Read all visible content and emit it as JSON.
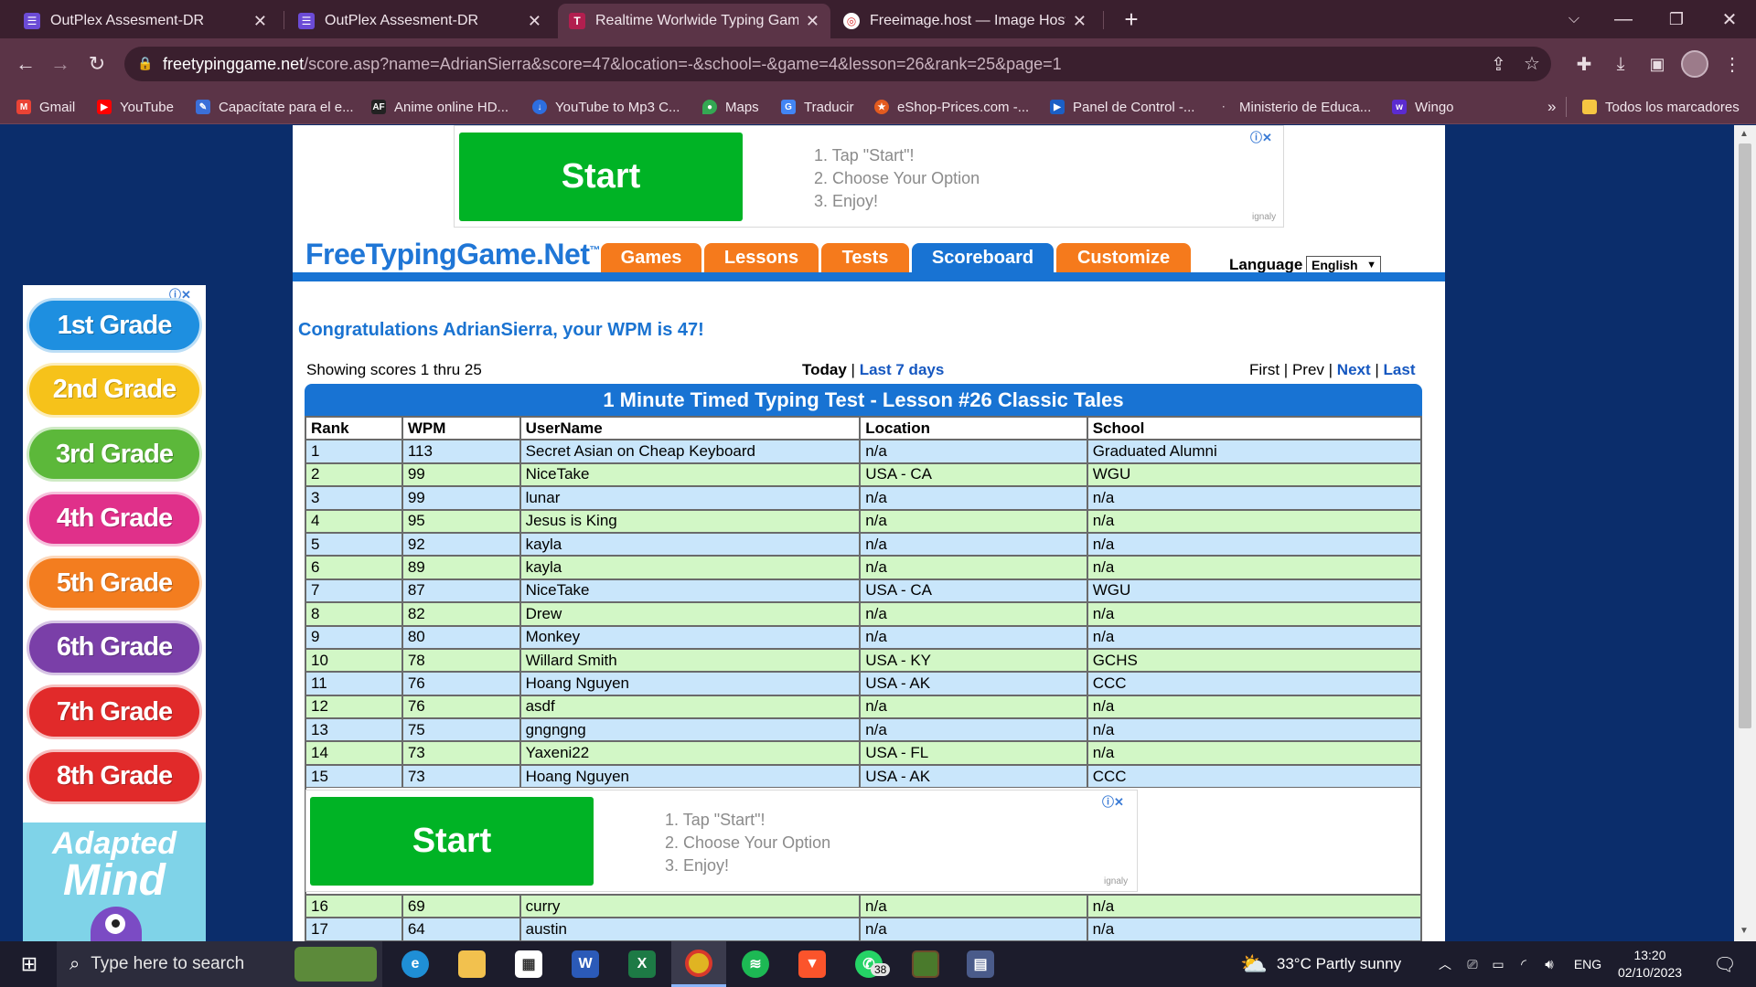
{
  "tabs": [
    {
      "label": "OutPlex Assesment-DR",
      "icon": "form-icon"
    },
    {
      "label": "OutPlex Assesment-DR",
      "icon": "form-icon"
    },
    {
      "label": "Realtime Worlwide Typing Game",
      "icon": "t-logo-icon"
    },
    {
      "label": "Freeimage.host — Image Hosting",
      "icon": "freeimage-icon"
    }
  ],
  "url": {
    "domain": "freetypinggame.net",
    "path": "/score.asp?name=AdrianSierra&score=47&location=-&school=-&game=4&lesson=26&rank=25&page=1"
  },
  "bookmarks": [
    "Gmail",
    "YouTube",
    "Capacítate para el e...",
    "Anime online HD...",
    "YouTube to Mp3 C...",
    "Maps",
    "Traducir",
    "eShop-Prices.com -...",
    "Panel de Control -...",
    "Ministerio de Educa...",
    "Wingo"
  ],
  "bookmarks_more": "»",
  "all_bookmarks": "Todos los marcadores",
  "ad": {
    "start": "Start",
    "steps": [
      "1. Tap \"Start\"!",
      "2. Choose Your Option",
      "3. Enjoy!"
    ],
    "brand": "ignaly"
  },
  "site": {
    "logo": "FreeTypingGame.Net",
    "logo_tm": "™",
    "nav": [
      "Games",
      "Lessons",
      "Tests",
      "Scoreboard",
      "Customize"
    ],
    "language_label": "Language",
    "language_value": "English"
  },
  "congrats": "Congratulations AdrianSierra, your WPM is 47!",
  "showing": "Showing scores 1 thru 25",
  "period": {
    "today": "Today",
    "sep": "|",
    "last7": "Last 7 days"
  },
  "paging": {
    "first": "First",
    "prev": "Prev",
    "next": "Next",
    "last": "Last",
    "sep": "|"
  },
  "table_title": "1 Minute Timed Typing Test - Lesson #26 Classic Tales",
  "columns": [
    "Rank",
    "WPM",
    "UserName",
    "Location",
    "School"
  ],
  "rows": [
    [
      "1",
      "113",
      "Secret Asian on Cheap Keyboard",
      "n/a",
      "Graduated Alumni"
    ],
    [
      "2",
      "99",
      "NiceTake",
      "USA - CA",
      "WGU"
    ],
    [
      "3",
      "99",
      "lunar",
      "n/a",
      "n/a"
    ],
    [
      "4",
      "95",
      "Jesus is King",
      "n/a",
      "n/a"
    ],
    [
      "5",
      "92",
      "kayla",
      "n/a",
      "n/a"
    ],
    [
      "6",
      "89",
      "kayla",
      "n/a",
      "n/a"
    ],
    [
      "7",
      "87",
      "NiceTake",
      "USA - CA",
      "WGU"
    ],
    [
      "8",
      "82",
      "Drew",
      "n/a",
      "n/a"
    ],
    [
      "9",
      "80",
      "Monkey",
      "n/a",
      "n/a"
    ],
    [
      "10",
      "78",
      "Willard Smith",
      "USA - KY",
      "GCHS"
    ],
    [
      "11",
      "76",
      "Hoang Nguyen",
      "USA - AK",
      "CCC"
    ],
    [
      "12",
      "76",
      "asdf",
      "n/a",
      "n/a"
    ],
    [
      "13",
      "75",
      "gngngng",
      "n/a",
      "n/a"
    ],
    [
      "14",
      "73",
      "Yaxeni22",
      "USA - FL",
      "n/a"
    ],
    [
      "15",
      "73",
      "Hoang Nguyen",
      "USA - AK",
      "CCC"
    ]
  ],
  "rows_after_ad": [
    [
      "16",
      "69",
      "curry",
      "n/a",
      "n/a"
    ],
    [
      "17",
      "64",
      "austin",
      "n/a",
      "n/a"
    ]
  ],
  "side_ad": {
    "grades": [
      "1st Grade",
      "2nd Grade",
      "3rd Grade",
      "4th Grade",
      "5th Grade",
      "6th Grade",
      "7th Grade",
      "8th Grade"
    ],
    "grade_colors": [
      "#1e8fe0",
      "#f6c21a",
      "#5cb83a",
      "#e0308a",
      "#f37d1f",
      "#7a3fa8",
      "#e12a2a",
      "#e12a2a"
    ],
    "brand_top": "Adapted",
    "brand_bottom": "Mind"
  },
  "taskbar": {
    "search_placeholder": "Type here to search",
    "weather": "33°C  Partly sunny",
    "lang": "ENG",
    "time": "13:20",
    "date": "02/10/2023",
    "whatsapp_badge": "38"
  }
}
